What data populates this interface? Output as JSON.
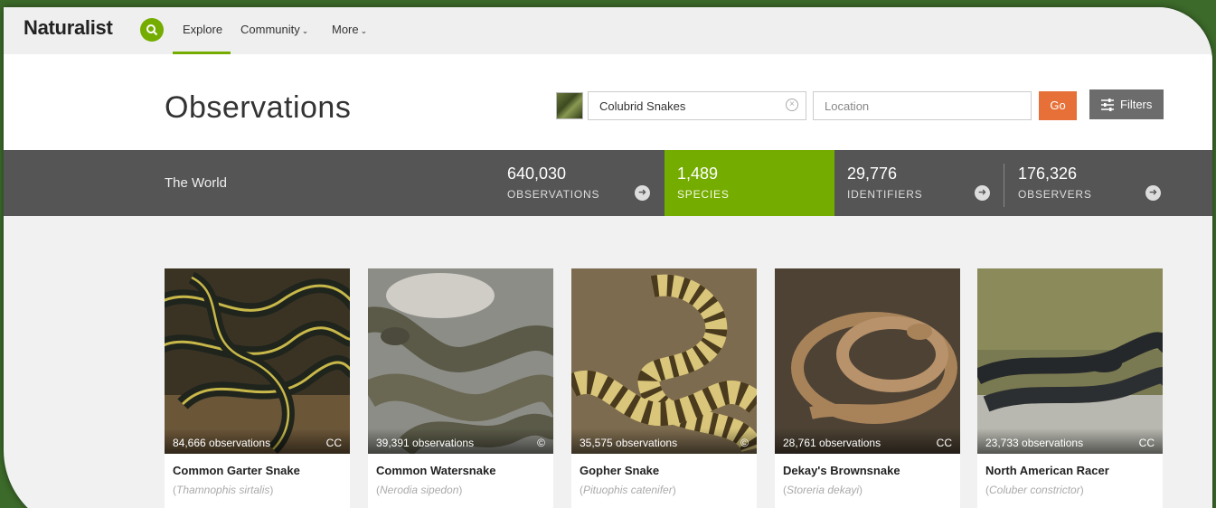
{
  "brand": {
    "name": "Naturalist"
  },
  "nav": {
    "explore": "Explore",
    "community": "Community",
    "more": "More"
  },
  "header": {
    "title": "Observations",
    "taxon_value": "Colubrid Snakes",
    "location_placeholder": "Location",
    "go_label": "Go",
    "filters_label": "Filters"
  },
  "stats": {
    "place": "The World",
    "observations": {
      "count": "640,030",
      "label": "OBSERVATIONS"
    },
    "species": {
      "count": "1,489",
      "label": "SPECIES"
    },
    "identifiers": {
      "count": "29,776",
      "label": "IDENTIFIERS"
    },
    "observers": {
      "count": "176,326",
      "label": "OBSERVERS"
    }
  },
  "colors": {
    "accent": "#74ac00",
    "go_button": "#e67037",
    "stats_bar": "#555555"
  },
  "species_cards": [
    {
      "obs": "84,666 observations",
      "license": "CC",
      "common": "Common Garter Snake",
      "scientific": "Thamnophis sirtalis"
    },
    {
      "obs": "39,391 observations",
      "license": "©",
      "common": "Common Watersnake",
      "scientific": "Nerodia sipedon"
    },
    {
      "obs": "35,575 observations",
      "license": "©",
      "common": "Gopher Snake",
      "scientific": "Pituophis catenifer"
    },
    {
      "obs": "28,761 observations",
      "license": "CC",
      "common": "Dekay's Brownsnake",
      "scientific": "Storeria dekayi"
    },
    {
      "obs": "23,733 observations",
      "license": "CC",
      "common": "North American Racer",
      "scientific": "Coluber constrictor"
    }
  ]
}
